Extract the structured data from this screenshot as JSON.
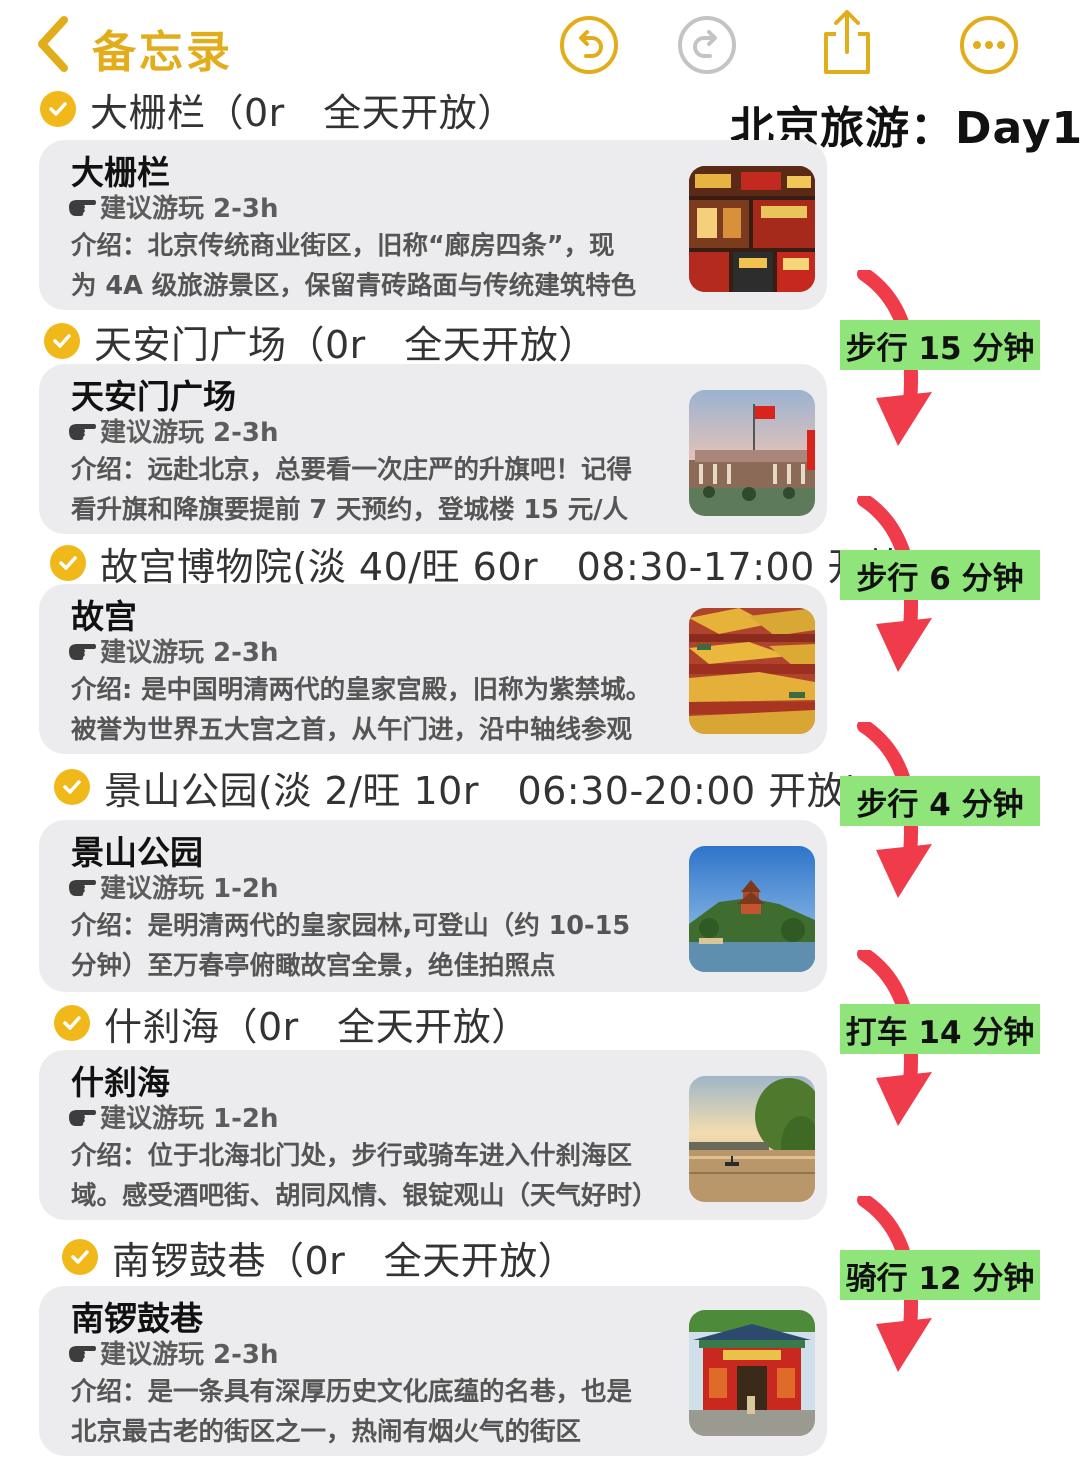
{
  "nav": {
    "back_label": "备忘录",
    "accent": "#e2ad1b",
    "icons": [
      "chevron-left-icon",
      "undo-icon",
      "redo-icon",
      "share-icon",
      "more-icon"
    ]
  },
  "day_title": "北京旅游：Day1",
  "spots": [
    {
      "header": "大栅栏（0r　全天开放）",
      "title": "大栅栏",
      "suggestion": "建议游玩 2-3h",
      "desc_lines": [
        "介绍：北京传统商业街区，旧称“廊房四条”，现",
        "为 4A 级旅游景区，保留青砖路面与传统建筑特色"
      ]
    },
    {
      "header": "天安门广场（0r　全天开放）",
      "title": "天安门广场",
      "suggestion": "建议游玩 2-3h",
      "desc_lines": [
        "介绍：远赴北京，总要看一次庄严的升旗吧！记得",
        "看升旗和降旗要提前 7 天预约，登城楼 15 元/人"
      ]
    },
    {
      "header": "故宫博物院(淡 40/旺 60r　08:30-17:00 开放)",
      "title": "故宫",
      "suggestion": "建议游玩 2-3h",
      "desc_lines": [
        "介绍: 是中国明清两代的皇家宫殿，旧称为紫禁城。",
        "被誉为世界五大宫之首，从午门进，沿中轴线参观"
      ]
    },
    {
      "header": "景山公园(淡 2/旺 10r　06:30-20:00 开放)",
      "title": "景山公园",
      "suggestion": "建议游玩 1-2h",
      "desc_lines": [
        "介绍：是明清两代的皇家园林,可登山（约 10-15",
        "分钟）至万春亭俯瞰故宫全景，绝佳拍照点"
      ]
    },
    {
      "header": "什刹海（0r　全天开放）",
      "title": "什刹海",
      "suggestion": "建议游玩 1-2h",
      "desc_lines": [
        "介绍：位于北海北门处，步行或骑车进入什刹海区",
        "域。感受酒吧街、胡同风情、银锭观山（天气好时）"
      ]
    },
    {
      "header": "南锣鼓巷（0r　全天开放）",
      "title": "南锣鼓巷",
      "suggestion": "建议游玩 2-3h",
      "desc_lines": [
        "介绍：是一条具有深厚历史文化底蕴的名巷，也是",
        "北京最古老的街区之一，热闹有烟火气的街区"
      ]
    }
  ],
  "transits": [
    "步行 15 分钟",
    "步行 6 分钟",
    "步行 4 分钟",
    "打车 14 分钟",
    "骑行 12 分钟"
  ],
  "colors": {
    "check": "#f1b81a",
    "card_bg": "#ececee",
    "tag_bg": "#8fe47a",
    "arrow": "#ef3b4a"
  }
}
